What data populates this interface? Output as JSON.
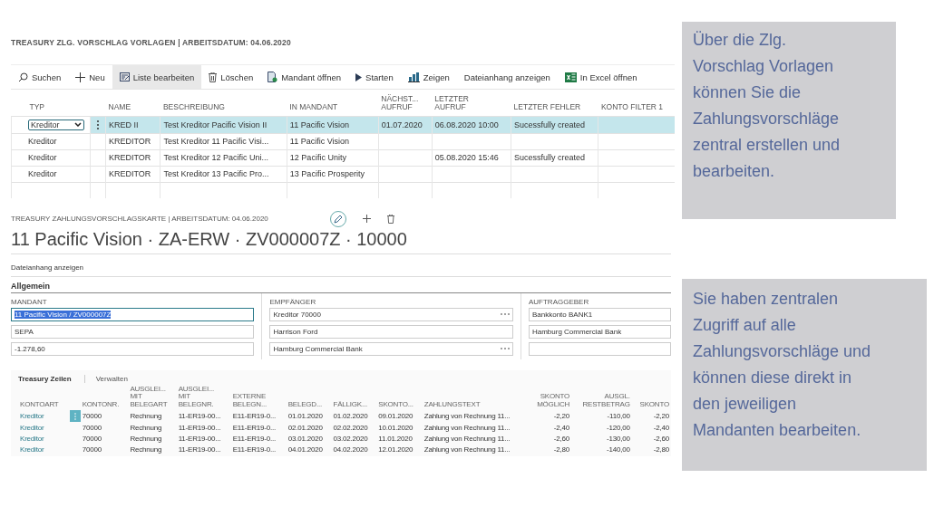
{
  "list_page": {
    "title": "TREASURY ZLG. VORSCHLAG VORLAGEN | ARBEITSDATUM: 04.06.2020",
    "actions": [
      {
        "label": "Suchen",
        "selected": false
      },
      {
        "label": "Neu",
        "selected": false
      },
      {
        "label": "Liste bearbeiten",
        "selected": true
      },
      {
        "label": "Löschen",
        "selected": false
      },
      {
        "label": "Mandant öffnen",
        "selected": false
      },
      {
        "label": "Starten",
        "selected": false
      },
      {
        "label": "Zeigen",
        "selected": false
      },
      {
        "label": "Dateianhang anzeigen",
        "selected": false
      },
      {
        "label": "In Excel öffnen",
        "selected": false
      }
    ],
    "columns": [
      "TYP",
      "NAME",
      "BESCHREIBUNG",
      "IN MANDANT",
      "NÄCHST...\nAUFRUF",
      "LETZTER\nAUFRUF",
      "LETZTER FEHLER",
      "KONTO FILTER 1"
    ],
    "rows": [
      {
        "selected": true,
        "cells": [
          "Kreditor",
          "KRED II",
          "Test Kreditor Pacific Vision II",
          "11 Pacific Vision",
          "01.07.2020",
          "06.08.2020 10:00",
          "Sucessfully created"
        ]
      },
      {
        "selected": false,
        "cells": [
          "Kreditor",
          "KREDITOR",
          "Test Kreditor 11 Pacific Visi...",
          "11 Pacific Vision",
          "",
          "",
          ""
        ]
      },
      {
        "selected": false,
        "cells": [
          "Kreditor",
          "KREDITOR",
          "Test Kreditor 12 Pacific Uni...",
          "12 Pacific Unity",
          "",
          "05.08.2020 15:46",
          "Sucessfully created"
        ]
      },
      {
        "selected": false,
        "cells": [
          "Kreditor",
          "KREDITOR",
          "Test Kreditor 13 Pacific Pro...",
          "13 Pacific Prosperity",
          "",
          "",
          ""
        ]
      }
    ]
  },
  "card_page": {
    "breadcrumb": "TREASURY ZAHLUNGSVORSCHLAGSKARTE | ARBEITSDATUM: 04.06.2020",
    "title": "11 Pacific Vision · ZA-ERW · ZV000007Z · 10000",
    "action": "Dateianhang anzeigen",
    "section": "Allgemein",
    "groups": [
      {
        "label": "MANDANT",
        "fields": [
          {
            "value": "11 Pacific Vision / ZV000007Z",
            "selected": true,
            "lookup": false
          },
          {
            "value": "SEPA",
            "selected": false,
            "lookup": false
          },
          {
            "value": "-1.278,60",
            "selected": false,
            "lookup": false
          }
        ]
      },
      {
        "label": "EMPFÄNGER",
        "fields": [
          {
            "value": "Kreditor 70000",
            "selected": false,
            "lookup": true
          },
          {
            "value": "Harrison Ford",
            "selected": false,
            "lookup": false
          },
          {
            "value": "Hamburg Commercial Bank",
            "selected": false,
            "lookup": true
          }
        ]
      },
      {
        "label": "AUFTRAGGEBER",
        "fields": [
          {
            "value": "Bankkonto BANK1",
            "selected": false,
            "lookup": false
          },
          {
            "value": "Hamburg Commercial Bank",
            "selected": false,
            "lookup": false
          },
          {
            "selected": false,
            "lookup": false
          }
        ]
      }
    ],
    "lines": {
      "tabs": [
        {
          "label": "Treasury Zeilen",
          "selected": true
        },
        {
          "label": "Verwalten",
          "selected": false
        }
      ],
      "columns": [
        "KONTOART",
        "KONTONR.",
        "AUSGLEI...\nMIT\nBELEGART",
        "AUSGLEI...\nMIT\nBELEGNR.",
        "EXTERNE\nBELEGN...",
        "BELEGD...",
        "FÄLLIGK...",
        "SKONTO...",
        "ZAHLUNGSTEXT",
        "SKONTO\nMÖGLICH",
        "AUSGL.\nRESTBETRAG",
        "SKONTO"
      ],
      "rows": [
        {
          "selected": true,
          "cells": [
            "Kreditor",
            "70000",
            "Rechnung",
            "11-ER19-00...",
            "E11-ER19-0...",
            "01.01.2020",
            "01.02.2020",
            "09.01.2020",
            "Zahlung von Rechnung 11...",
            "-2,20",
            "-110,00",
            "-2,20"
          ]
        },
        {
          "selected": false,
          "cells": [
            "Kreditor",
            "70000",
            "Rechnung",
            "11-ER19-00...",
            "E11-ER19-0...",
            "02.01.2020",
            "02.02.2020",
            "10.01.2020",
            "Zahlung von Rechnung 11...",
            "-2,40",
            "-120,00",
            "-2,40"
          ]
        },
        {
          "selected": false,
          "cells": [
            "Kreditor",
            "70000",
            "Rechnung",
            "11-ER19-00...",
            "E11-ER19-0...",
            "03.01.2020",
            "03.02.2020",
            "11.01.2020",
            "Zahlung von Rechnung 11...",
            "-2,60",
            "-130,00",
            "-2,60"
          ]
        },
        {
          "selected": false,
          "cells": [
            "Kreditor",
            "70000",
            "Rechnung",
            "11-ER19-00...",
            "E11-ER19-0...",
            "04.01.2020",
            "04.02.2020",
            "12.01.2020",
            "Zahlung von Rechnung 11...",
            "-2,80",
            "-140,00",
            "-2,80"
          ]
        }
      ]
    }
  },
  "callouts": [
    "Über die Zlg. Vorschlag Vorlagen können Sie die Zahlungsvorschläge zentral erstellen und bearbeiten.",
    "Sie haben zentralen Zugriff auf alle Zahlungsvorschläge und können diese direkt in den jeweiligen Mandanten bearbeiten."
  ]
}
